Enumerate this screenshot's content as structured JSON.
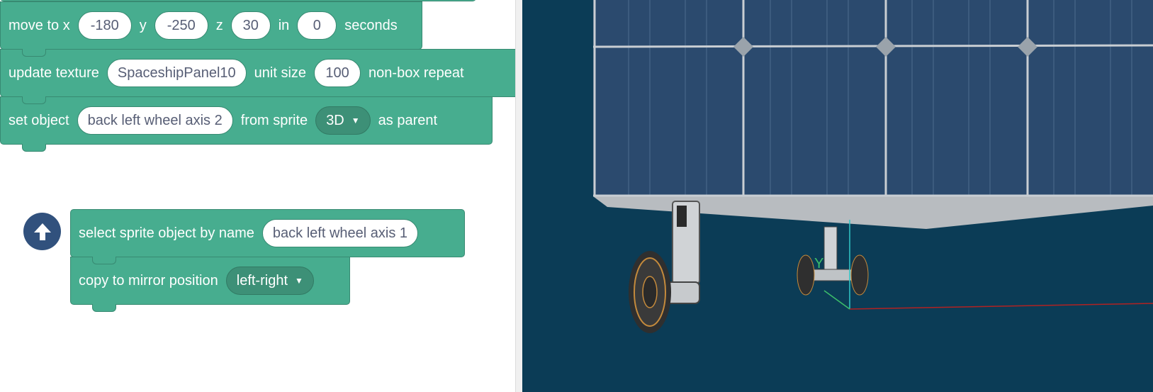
{
  "blocks": {
    "move": {
      "label": "move to x",
      "x": "-180",
      "y_label": "y",
      "y": "-250",
      "z_label": "z",
      "z": "30",
      "in_label": "in",
      "seconds_value": "0",
      "seconds_label": "seconds"
    },
    "texture": {
      "label": "update texture",
      "texture": "SpaceshipPanel10",
      "unit_label": "unit size",
      "unit": "100",
      "repeat_label": "non-box repeat"
    },
    "parent": {
      "label": "set object",
      "object": "back left wheel axis 2",
      "from_label": "from sprite",
      "sprite": "3D",
      "suffix": "as parent"
    },
    "select": {
      "label": "select sprite object by name",
      "name": "back left wheel axis 1"
    },
    "mirror": {
      "label": "copy to mirror position",
      "option": "left-right"
    }
  },
  "stage": {
    "axis_label": "Y"
  },
  "colors": {
    "block": "#47ad8f",
    "block_border": "#388a72",
    "dropdown": "#3d9077",
    "go_button": "#31517d",
    "stage_bg": "#0b3c56",
    "panel": "#2b4a6e"
  },
  "icons": {
    "go": "arrow-up-icon",
    "dropdown": "caret-down-icon"
  }
}
